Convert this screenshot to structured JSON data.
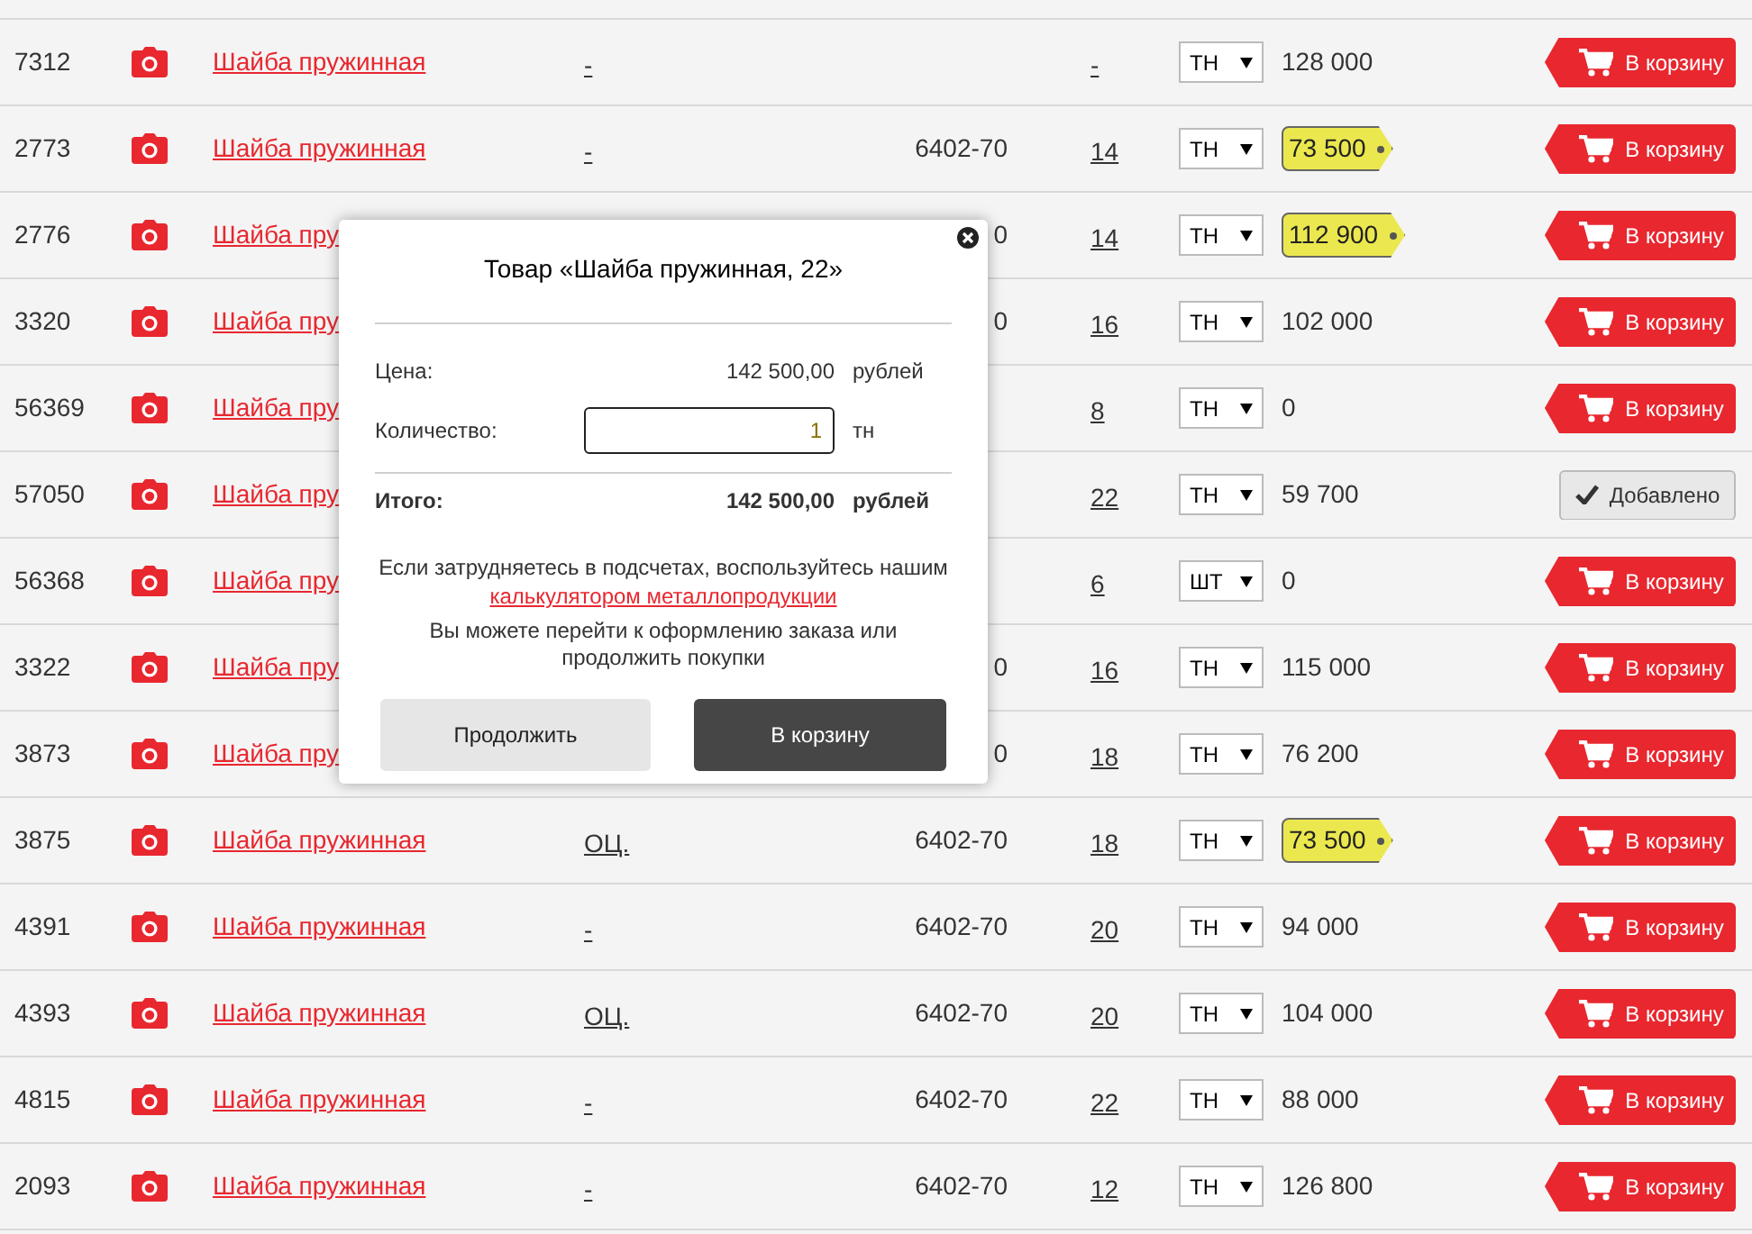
{
  "rows": [
    {
      "id": "7312",
      "name": "Шайба пружинная",
      "coating": "-",
      "size": "-",
      "unit": "ТН",
      "price": "128 000",
      "price_tag": false,
      "added": false,
      "button": "В корзину"
    },
    {
      "id": "2773",
      "name": "Шайба пружинная",
      "coating": "-",
      "gost": "6402-70",
      "size": "14",
      "unit": "ТН",
      "price": "73 500",
      "price_tag": true,
      "added": false,
      "button": "В корзину"
    },
    {
      "id": "2776",
      "name": "Шайба пру",
      "gost": "0",
      "size": "14",
      "unit": "ТН",
      "price": "112 900",
      "price_tag": true,
      "added": false,
      "button": "В корзину"
    },
    {
      "id": "3320",
      "name": "Шайба пру",
      "gost": "0",
      "size": "16",
      "unit": "ТН",
      "price": "102 000",
      "price_tag": false,
      "added": false,
      "button": "В корзину"
    },
    {
      "id": "56369",
      "name": "Шайба пру",
      "size": "8",
      "unit": "ТН",
      "price": "0",
      "price_tag": false,
      "added": false,
      "button": "В корзину"
    },
    {
      "id": "57050",
      "name": "Шайба пру",
      "size": "22",
      "unit": "ТН",
      "price": "59 700",
      "price_tag": false,
      "added": true,
      "button": "Добавлено"
    },
    {
      "id": "56368",
      "name": "Шайба пру",
      "size": "6",
      "unit": "ШТ",
      "price": "0",
      "price_tag": false,
      "added": false,
      "button": "В корзину"
    },
    {
      "id": "3322",
      "name": "Шайба пру",
      "gost": "0",
      "size": "16",
      "unit": "ТН",
      "price": "115 000",
      "price_tag": false,
      "added": false,
      "button": "В корзину"
    },
    {
      "id": "3873",
      "name": "Шайба пру",
      "gost": "0",
      "size": "18",
      "unit": "ТН",
      "price": "76 200",
      "price_tag": false,
      "added": false,
      "button": "В корзину"
    },
    {
      "id": "3875",
      "name": "Шайба пружинная",
      "coating": "ОЦ.",
      "gost": "6402-70",
      "size": "18",
      "unit": "ТН",
      "price": "73 500",
      "price_tag": true,
      "added": false,
      "button": "В корзину"
    },
    {
      "id": "4391",
      "name": "Шайба пружинная",
      "coating": "-",
      "gost": "6402-70",
      "size": "20",
      "unit": "ТН",
      "price": "94 000",
      "price_tag": false,
      "added": false,
      "button": "В корзину"
    },
    {
      "id": "4393",
      "name": "Шайба пружинная",
      "coating": "ОЦ.",
      "gost": "6402-70",
      "size": "20",
      "unit": "ТН",
      "price": "104 000",
      "price_tag": false,
      "added": false,
      "button": "В корзину"
    },
    {
      "id": "4815",
      "name": "Шайба пружинная",
      "coating": "-",
      "gost": "6402-70",
      "size": "22",
      "unit": "ТН",
      "price": "88 000",
      "price_tag": false,
      "added": false,
      "button": "В корзину"
    },
    {
      "id": "2093",
      "name": "Шайба пружинная",
      "coating": "-",
      "gost": "6402-70",
      "size": "12",
      "unit": "ТН",
      "price": "126 800",
      "price_tag": false,
      "added": false,
      "button": "В корзину"
    }
  ],
  "modal": {
    "title": "Товар «Шайба пружинная, 22»",
    "price_label": "Цена:",
    "price": "142 500,00",
    "price_unit": "рублей",
    "qty_label": "Количество:",
    "qty": "1",
    "qty_unit": "тн",
    "total_label": "Итого:",
    "total": "142 500,00",
    "total_unit": "рублей",
    "hint": "Если затрудняетесь в подсчетах, воспользуйтесь нашим",
    "hint_link": "калькулятором металлопродукции",
    "note": "Вы можете перейти к оформлению заказа или продолжить покупки",
    "continue": "Продолжить",
    "cart": "В корзину"
  }
}
